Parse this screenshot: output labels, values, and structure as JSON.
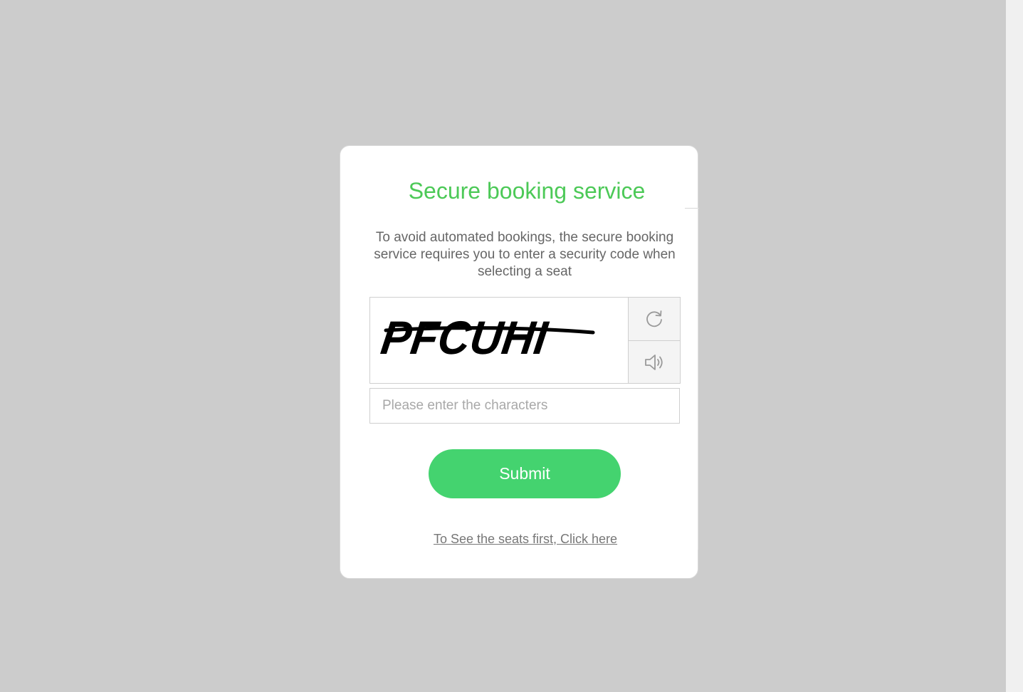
{
  "dialog": {
    "title": "Secure booking service",
    "description": "To avoid automated bookings, the secure booking service requires you to enter a security code when selecting a seat",
    "captcha": {
      "text": "PFCUHI",
      "refresh_icon": "refresh-icon",
      "audio_icon": "speaker-icon"
    },
    "input": {
      "placeholder": "Please enter the characters",
      "value": ""
    },
    "submit_label": "Submit",
    "seats_link": "To See the seats first, Click here"
  },
  "colors": {
    "title": "#4cc957",
    "submit_bg": "#44d36f",
    "page_bg": "#cccccc"
  }
}
